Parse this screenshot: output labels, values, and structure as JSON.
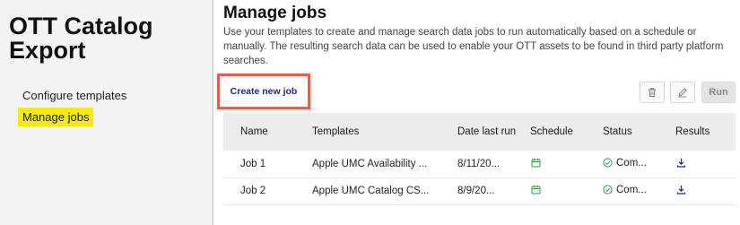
{
  "sidebar": {
    "title": "OTT Catalog Export",
    "nav": [
      {
        "label": "Configure templates",
        "active": false
      },
      {
        "label": "Manage jobs",
        "active": true
      }
    ]
  },
  "main": {
    "title": "Manage jobs",
    "description": "Use your templates to create and manage search data jobs to run automatically based on a schedule or manually. The resulting search data can be used to enable your OTT assets to be found in third party platform searches.",
    "create_label": "Create new job",
    "run_label": "Run",
    "toolbar_icons": [
      "trash-icon",
      "pencil-icon"
    ]
  },
  "table": {
    "headers": [
      "Name",
      "Templates",
      "Date last run",
      "Schedule",
      "Status",
      "Results"
    ],
    "rows": [
      {
        "name": "Job 1",
        "template": "Apple UMC Availability ...",
        "date": "8/11/20...",
        "schedule_icon": "calendar-icon",
        "status": "Com...",
        "status_icon": "check-circle-icon",
        "results_icon": "download-icon"
      },
      {
        "name": "Job 2",
        "template": "Apple UMC Catalog CS...",
        "date": "8/9/20...",
        "schedule_icon": "calendar-icon",
        "status": "Com...",
        "status_icon": "check-circle-icon",
        "results_icon": "download-icon"
      }
    ]
  },
  "colors": {
    "highlight": "#f5e912",
    "callout": "#ef5a4c",
    "link": "#1a2a8a",
    "success": "#2e9a4a"
  }
}
